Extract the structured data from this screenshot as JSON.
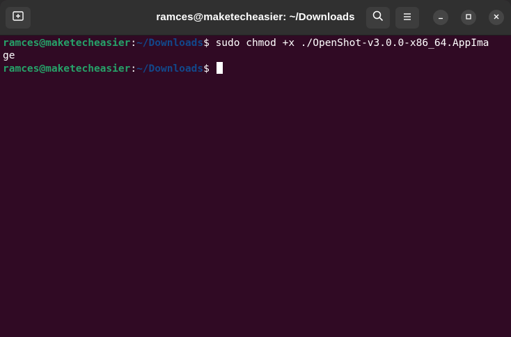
{
  "window": {
    "title": "ramces@maketecheasier: ~/Downloads"
  },
  "header": {
    "icons": {
      "new_tab": "new-tab-icon",
      "search": "search-icon",
      "menu": "hamburger-menu-icon",
      "minimize": "minimize-icon",
      "maximize": "maximize-icon",
      "close": "close-icon"
    }
  },
  "terminal": {
    "lines": [
      {
        "user_host": "ramces@maketecheasier",
        "colon": ":",
        "path": "~/Downloads",
        "prompt": "$ ",
        "command": "sudo chmod +x ./OpenShot-v3.0.0-x86_64.AppIma",
        "wrap": "ge"
      },
      {
        "user_host": "ramces@maketecheasier",
        "colon": ":",
        "path": "~/Downloads",
        "prompt": "$ ",
        "command": ""
      }
    ]
  },
  "colors": {
    "background": "#300a24",
    "titlebar": "#303030",
    "user_host": "#26a269",
    "path": "#12488b",
    "text": "#ffffff"
  }
}
